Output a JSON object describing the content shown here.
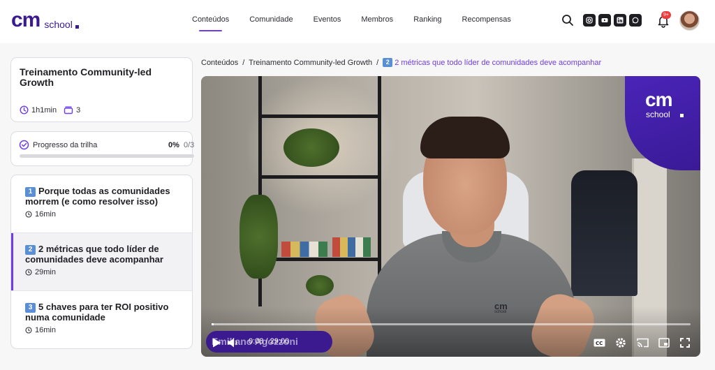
{
  "brand": {
    "logo_main": "cm",
    "logo_sub": "school"
  },
  "nav": {
    "items": [
      {
        "label": "Conteúdos",
        "active": true
      },
      {
        "label": "Comunidade"
      },
      {
        "label": "Eventos"
      },
      {
        "label": "Membros"
      },
      {
        "label": "Ranking"
      },
      {
        "label": "Recompensas"
      }
    ]
  },
  "header": {
    "social": [
      "instagram-icon",
      "youtube-icon",
      "linkedin-icon",
      "whatsapp-icon"
    ],
    "notification_badge": "9+"
  },
  "course": {
    "title": "Treinamento Community-led Growth",
    "duration": "1h1min",
    "lesson_count": "3"
  },
  "progress": {
    "label": "Progresso da trilha",
    "percent": "0%",
    "count": "0/3",
    "value": 0
  },
  "lessons": [
    {
      "num": "1",
      "title": "Porque todas as comunidades morrem (e como resolver isso)",
      "duration": "16min",
      "active": false
    },
    {
      "num": "2",
      "title": "2 métricas que todo líder de comunidades deve acompanhar",
      "duration": "29min",
      "active": true
    },
    {
      "num": "3",
      "title": "5 chaves para ter ROI positivo numa comunidade",
      "duration": "16min",
      "active": false
    }
  ],
  "breadcrumb": {
    "root": "Conteúdos",
    "course": "Treinamento Community-led Growth",
    "current_num": "2",
    "current": "2 métricas que todo líder de comunidades deve acompanhar"
  },
  "video": {
    "brand_main": "cm",
    "brand_sub": "school",
    "shirt_logo": "cm",
    "shirt_sub": "school",
    "presenter_overlay": "Emiliano Agozzoni",
    "current_time": "0:08",
    "total_time": "29:00",
    "progress_fraction": 0.005
  },
  "colors": {
    "accent": "#6d3ce8",
    "brand": "#3b1a8f",
    "badge": "#ef3b3b"
  }
}
